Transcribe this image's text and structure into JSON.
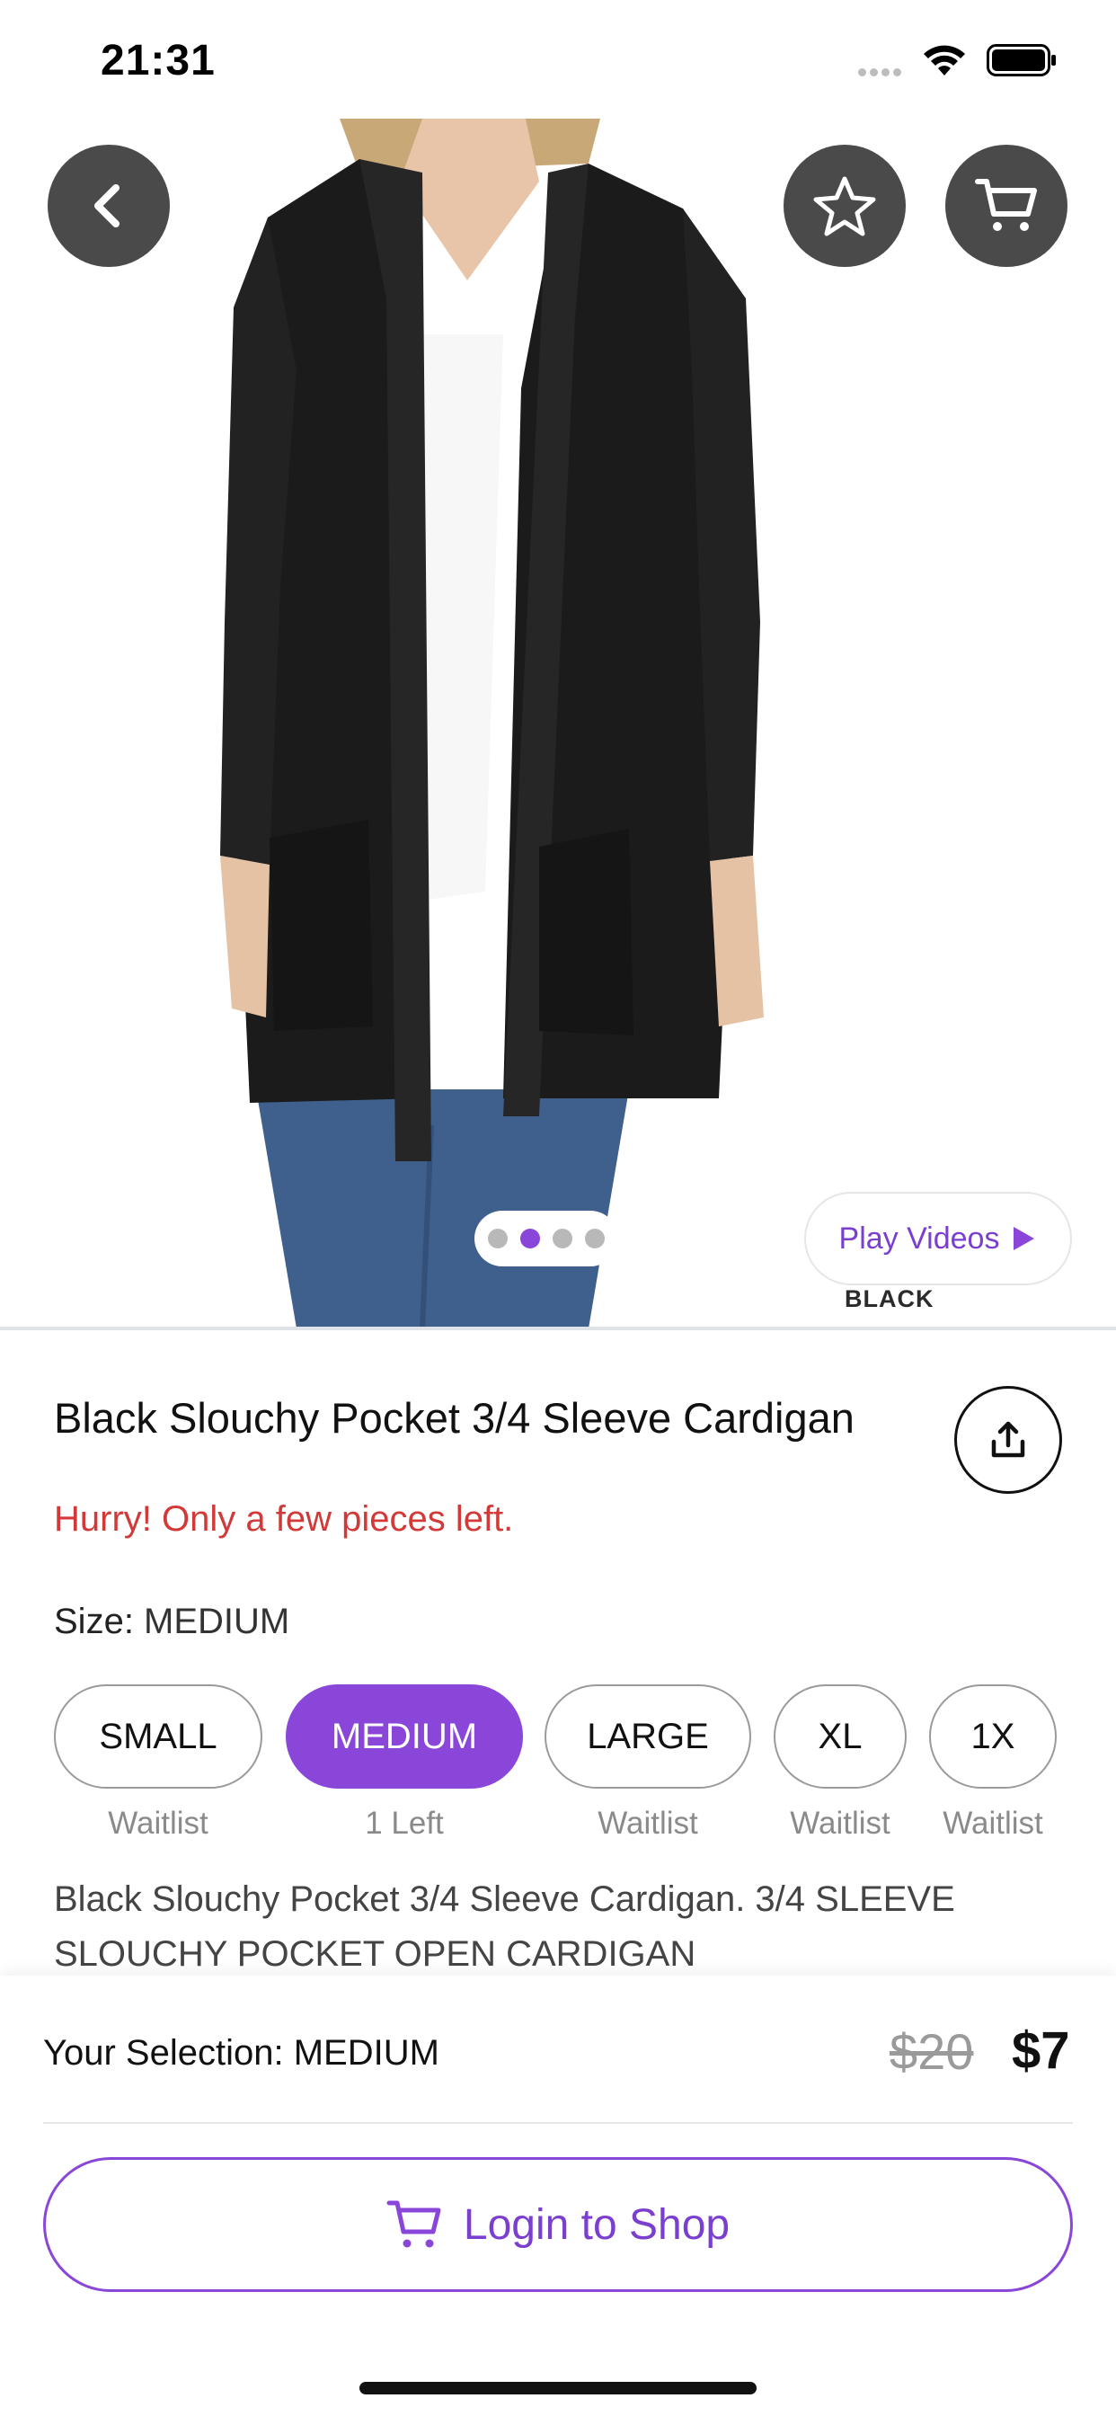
{
  "status_bar": {
    "time": "21:31"
  },
  "hero": {
    "pager_count": 4,
    "pager_active_index": 1,
    "play_videos_label": "Play Videos",
    "color_name": "BLACK"
  },
  "product": {
    "title": "Black Slouchy Pocket 3/4 Sleeve Cardigan",
    "urgency": "Hurry! Only a few pieces left.",
    "size_label": "Size: ",
    "size_value": "MEDIUM",
    "description": "Black Slouchy Pocket 3/4 Sleeve Cardigan. 3/4 SLEEVE SLOUCHY POCKET OPEN CARDIGAN"
  },
  "sizes": [
    {
      "label": "SMALL",
      "status": "Waitlist",
      "selected": false
    },
    {
      "label": "MEDIUM",
      "status": "1 Left",
      "selected": true
    },
    {
      "label": "LARGE",
      "status": "Waitlist",
      "selected": false
    },
    {
      "label": "XL",
      "status": "Waitlist",
      "selected": false
    },
    {
      "label": "1X",
      "status": "Waitlist",
      "selected": false
    }
  ],
  "bottom": {
    "selection_label": "Your Selection: MEDIUM",
    "price_original": "$20",
    "price_current": "$7",
    "login_button_label": "Login to Shop"
  },
  "icons": {
    "back": "chevron-left-icon",
    "favorite": "star-icon",
    "cart": "cart-icon",
    "share": "share-icon",
    "play": "play-icon"
  },
  "colors": {
    "accent": "#8a46d9",
    "urgency": "#d23a3a",
    "button_dark": "#4a4a4a"
  }
}
